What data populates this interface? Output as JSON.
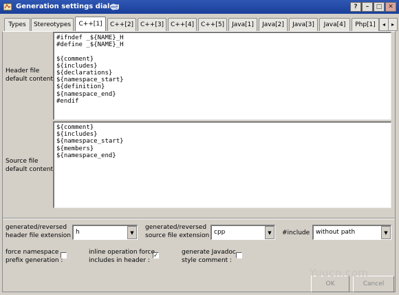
{
  "window": {
    "title": "Generation settings dialog",
    "buttons": {
      "help": "?",
      "minimize": "–",
      "maximize": "□",
      "close": "✕"
    }
  },
  "tabs": [
    {
      "label": "Types"
    },
    {
      "label": "Stereotypes"
    },
    {
      "label": "C++[1]",
      "active": true
    },
    {
      "label": "C++[2]"
    },
    {
      "label": "C++[3]"
    },
    {
      "label": "C++[4]"
    },
    {
      "label": "C++[5]"
    },
    {
      "label": "Java[1]"
    },
    {
      "label": "Java[2]"
    },
    {
      "label": "Java[3]"
    },
    {
      "label": "Java[4]"
    },
    {
      "label": "Php[1]"
    }
  ],
  "tab_scroll": {
    "left": "◂",
    "right": "▸"
  },
  "header": {
    "label": "Header file\ndefault content :",
    "content": "#ifndef _${NAME}_H\n#define _${NAME}_H\n\n${comment}\n${includes}\n${declarations}\n${namespace_start}\n${definition}\n${namespace_end}\n#endif"
  },
  "source": {
    "label": "Source file\ndefault content :",
    "content": "${comment}\n${includes}\n${namespace_start}\n${members}\n${namespace_end}"
  },
  "extensions": {
    "header_label": "generated/reversed\nheader file extension :",
    "header_value": "h",
    "source_label": "generated/reversed\nsource file extension :",
    "source_value": "cpp",
    "include_label": "#include :",
    "include_value": "without path",
    "arrow": "▼"
  },
  "options": {
    "force_namespace_label": "force namespace\nprefix generation :",
    "force_namespace_checked": false,
    "inline_force_label": "inline operation force\nincludes in header :",
    "inline_force_checked": true,
    "javadoc_label": "generate Javadoc\nstyle comment :",
    "javadoc_checked": false,
    "check_mark": "✓"
  },
  "buttons": {
    "ok": "OK",
    "cancel": "Cancel"
  },
  "watermark": "Yuucn.com"
}
